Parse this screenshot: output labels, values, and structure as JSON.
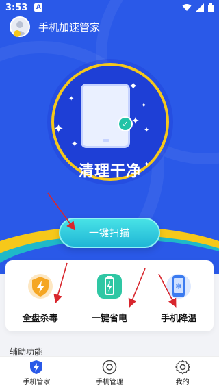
{
  "status_bar": {
    "time": "3:53",
    "notif": "A"
  },
  "header": {
    "title": "手机加速管家"
  },
  "hero": {
    "status_text": "清理干净"
  },
  "scan_button": {
    "label": "一键扫描"
  },
  "features": [
    {
      "label": "全盘杀毒",
      "icon": "shield-bolt-icon",
      "color": "#f5a623"
    },
    {
      "label": "一键省电",
      "icon": "battery-bolt-icon",
      "color": "#2fc7a4"
    },
    {
      "label": "手机降温",
      "icon": "phone-snowflake-icon",
      "color": "#3b7bf0"
    }
  ],
  "section": {
    "title": "辅助功能"
  },
  "bottom_nav": [
    {
      "label": "手机管家",
      "icon": "shield-bolt-icon",
      "active": true
    },
    {
      "label": "手机管理",
      "icon": "target-icon",
      "active": false
    },
    {
      "label": "我的",
      "icon": "gear-icon",
      "active": false
    }
  ],
  "colors": {
    "primary": "#2a59e8",
    "accent_yellow": "#f6c81a",
    "accent_teal": "#1fb9c9",
    "arrow": "#d8262d"
  }
}
